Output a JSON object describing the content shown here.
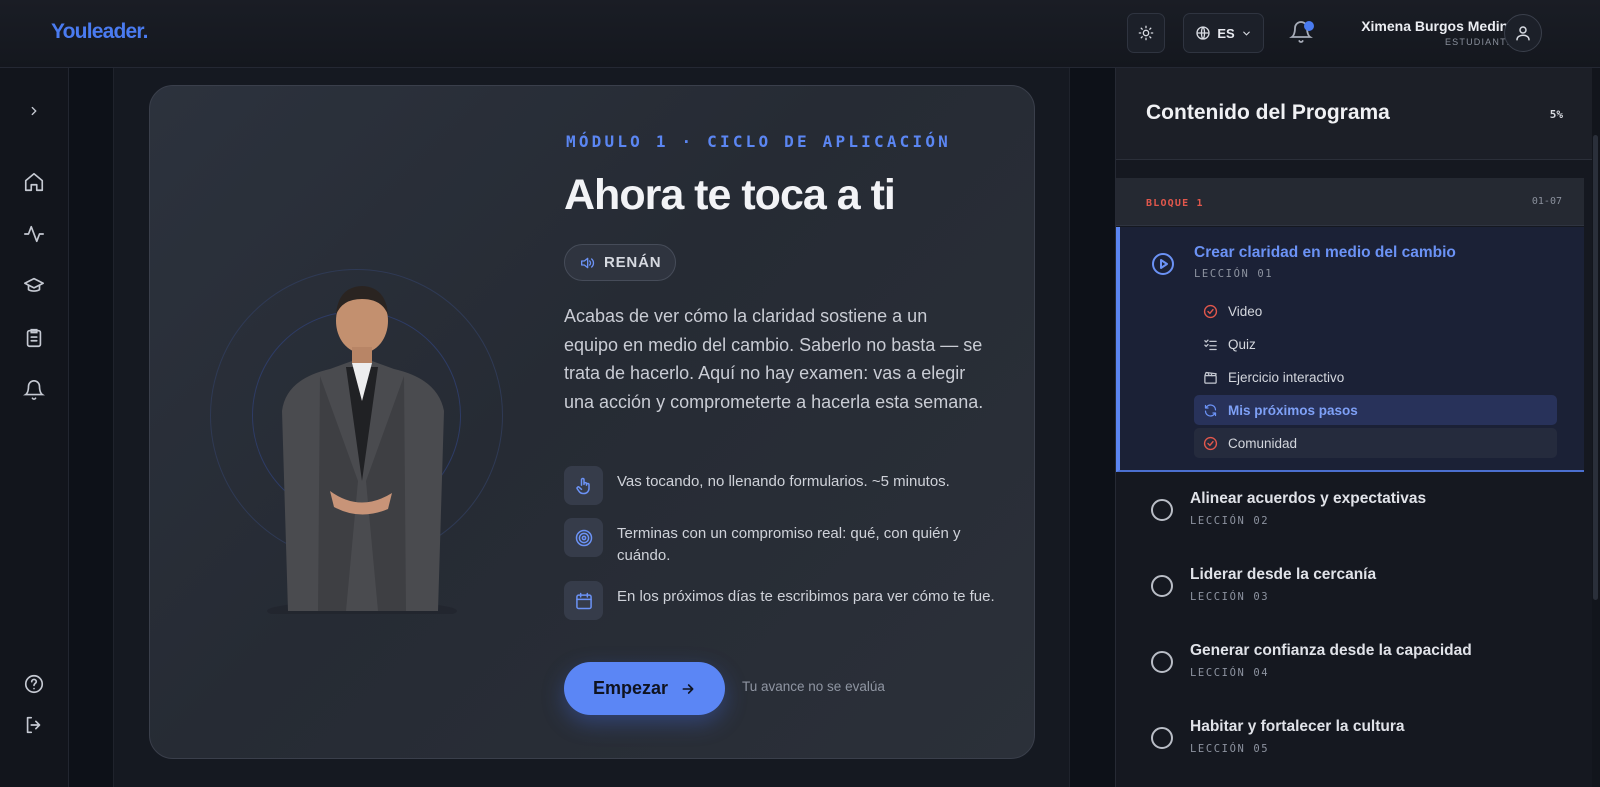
{
  "header": {
    "logo": "Youleader.",
    "language": "ES",
    "user_name": "Ximena Burgos Medina",
    "user_role": "ESTUDIANTE"
  },
  "sidebar": {
    "items": [
      {
        "icon": "chevron-right-icon"
      },
      {
        "icon": "home-icon"
      },
      {
        "icon": "activity-icon"
      },
      {
        "icon": "graduation-cap-icon"
      },
      {
        "icon": "clipboard-icon"
      },
      {
        "icon": "bell-icon"
      },
      {
        "icon": "help-icon"
      },
      {
        "icon": "logout-icon"
      }
    ]
  },
  "main": {
    "eyebrow": "MÓDULO 1 · CICLO DE APLICACIÓN",
    "title": "Ahora te toca a ti",
    "speaker": "RENÁN",
    "description": "Acabas de ver cómo la claridad sostiene a un equipo en medio del cambio. Saberlo no basta — se trata de hacerlo. Aquí no hay examen: vas a elegir una acción y comprometerte a hacerla esta semana.",
    "features": [
      {
        "icon": "hand-pointer-icon",
        "text": "Vas tocando, no llenando formularios. ~5 minutos."
      },
      {
        "icon": "target-icon",
        "text": "Terminas con un compromiso real: qué, con quién y cuándo."
      },
      {
        "icon": "calendar-icon",
        "text": "En los próximos días te escribimos para ver cómo te fue."
      }
    ],
    "start_label": "Empezar",
    "note": "Tu avance no se evalúa"
  },
  "program": {
    "title": "Contenido del Programa",
    "progress": "5%",
    "block_label": "BLOQUE 1",
    "block_range": "01-07",
    "active_lesson": {
      "title": "Crear claridad en medio del cambio",
      "number": "LECCIÓN 01",
      "items": [
        {
          "label": "Video",
          "icon": "check-circle-icon"
        },
        {
          "label": "Quiz",
          "icon": "list-check-icon"
        },
        {
          "label": "Ejercicio interactivo",
          "icon": "clapperboard-icon"
        },
        {
          "label": "Mis próximos pasos",
          "icon": "refresh-icon"
        },
        {
          "label": "Comunidad",
          "icon": "check-circle-icon"
        }
      ]
    },
    "lessons": [
      {
        "title": "Alinear acuerdos y expectativas",
        "number": "LECCIÓN 02"
      },
      {
        "title": "Liderar desde la cercanía",
        "number": "LECCIÓN 03"
      },
      {
        "title": "Generar confianza desde la capacidad",
        "number": "LECCIÓN 04"
      },
      {
        "title": "Habitar y fortalecer la cultura",
        "number": "LECCIÓN 05"
      }
    ]
  },
  "colors": {
    "accent": "#5b86f5",
    "block_label": "#e2574c",
    "check": "#e2574c"
  }
}
